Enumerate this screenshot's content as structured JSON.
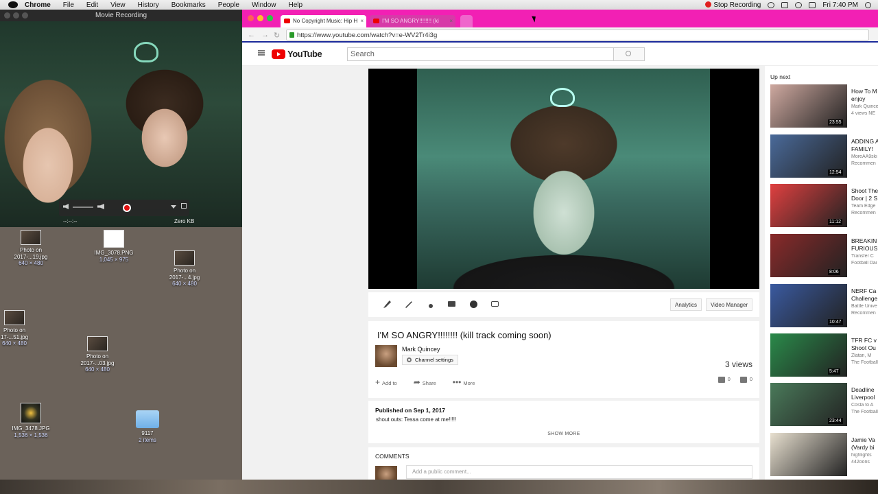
{
  "menubar": {
    "app": "Chrome",
    "items": [
      "File",
      "Edit",
      "View",
      "History",
      "Bookmarks",
      "People",
      "Window",
      "Help"
    ],
    "stop_recording": "Stop Recording",
    "clock": "Fri 7:40 PM"
  },
  "movie_window": {
    "title": "Movie Recording",
    "time": "--:--:--",
    "size": "Zero KB"
  },
  "desktop_icons": [
    {
      "name": "Photo on\n2017-...19.jpg",
      "line1": "Photo on",
      "line2": "2017-...19.jpg",
      "meta": "640 × 480"
    },
    {
      "name": "IMG_3078.PNG",
      "line1": "IMG_3078.PNG",
      "line2": "",
      "meta": "1,045 × 975"
    },
    {
      "name": "Photo on",
      "line1": "Photo on",
      "line2": "2017-...4.jpg",
      "meta": "640 × 480"
    },
    {
      "name": "Photo on",
      "line1": "Photo on",
      "line2": "17-...51.jpg",
      "meta": "640 × 480"
    },
    {
      "name": "Photo on",
      "line1": "Photo on",
      "line2": "2017-...03.jpg",
      "meta": "640 × 480"
    },
    {
      "name": "IMG_3478.JPG",
      "line1": "IMG_3478.JPG",
      "line2": "",
      "meta": "1,536 × 1,536"
    },
    {
      "name": "9117",
      "line1": "9117",
      "line2": "",
      "meta": "2 items"
    }
  ],
  "tabs": [
    {
      "label": "No Copyright Music: Hip H"
    },
    {
      "label": "I'M SO ANGRY!!!!!!!! (ki"
    }
  ],
  "address": {
    "url": "https://www.youtube.com/watch?v=e-WV2Tr4i3g"
  },
  "youtube": {
    "logo": "YouTube",
    "search_placeholder": "Search"
  },
  "toolbar": {
    "analytics": "Analytics",
    "video_manager": "Video Manager"
  },
  "video": {
    "title": "I'M SO ANGRY!!!!!!!! (kill track coming soon)",
    "channel": "Mark Quincey",
    "channel_settings": "Channel settings",
    "views": "3 views",
    "add_to": "Add to",
    "share": "Share",
    "more": "More",
    "likes": "0",
    "dislikes": "0",
    "published": "Published on Sep 1, 2017",
    "description": "shout outs: Tessa come at me!!!!!",
    "show_more": "SHOW MORE"
  },
  "comments": {
    "header": "COMMENTS",
    "placeholder": "Add a public comment..."
  },
  "sidebar": {
    "up_next": "Up next",
    "items": [
      {
        "title": "How To M",
        "title2": "enjoy",
        "channel": "Mark Quince",
        "extra": "4 views  NE",
        "duration": "23:55",
        "color": "#cfa9a0"
      },
      {
        "title": "ADDING A",
        "title2": "FAMILY!",
        "channel": "MoreAA9ski",
        "extra": "Recommen",
        "duration": "12:54",
        "color": "#4a6a9a"
      },
      {
        "title": "Shoot The",
        "title2": "Door | 2 S",
        "channel": "Team Edge",
        "extra": "Recommen",
        "duration": "11:12",
        "color": "#e04040"
      },
      {
        "title": "BREAKIN",
        "title2": "FURIOUS",
        "channel": "Transfer C",
        "extra": "Football Dai",
        "duration": "8:06",
        "color": "#8a2a2a"
      },
      {
        "title": "NERF Ca",
        "title2": "Challenge",
        "channel": "Battle Unive",
        "extra": "Recommen",
        "duration": "10:47",
        "color": "#3a5aa0"
      },
      {
        "title": "TFR FC v",
        "title2": "Shoot Ou",
        "channel": "Zlatan, M",
        "extra": "The Football",
        "duration": "5:47",
        "color": "#2a8a4a"
      },
      {
        "title": "Deadline",
        "title2": "Liverpool",
        "channel": "Costa to A",
        "extra": "The Football",
        "duration": "23:44",
        "color": "#4a7a5a"
      },
      {
        "title": "Jamie Va",
        "title2": "(Vardy bi",
        "channel": "highlights",
        "extra": "442oons",
        "duration": "",
        "color": "#e8e0d0"
      }
    ]
  }
}
